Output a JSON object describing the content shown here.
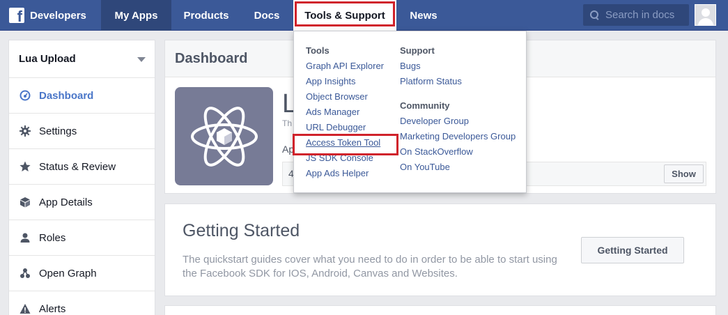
{
  "nav": {
    "brand": "Developers",
    "my_apps": "My Apps",
    "products": "Products",
    "docs": "Docs",
    "tools_support": "Tools & Support",
    "news": "News",
    "search_placeholder": "Search in docs"
  },
  "sidebar": {
    "app_name": "Lua Upload",
    "items": [
      {
        "label": "Dashboard",
        "icon": "dashboard-icon"
      },
      {
        "label": "Settings",
        "icon": "gear-icon"
      },
      {
        "label": "Status & Review",
        "icon": "star-icon"
      },
      {
        "label": "App Details",
        "icon": "cube-icon"
      },
      {
        "label": "Roles",
        "icon": "person-icon"
      },
      {
        "label": "Open Graph",
        "icon": "graph-icon"
      },
      {
        "label": "Alerts",
        "icon": "alert-icon"
      }
    ]
  },
  "dashboard": {
    "title": "Dashboard",
    "app_name_partial": "L",
    "app_sub_partial": "Th",
    "app_id_partial": "Ap",
    "secret_partial": "4",
    "show_label": "Show"
  },
  "getting_started": {
    "title": "Getting Started",
    "description": "The quickstart guides cover what you need to do in order to be able to start using the Facebook SDK for IOS, Android, Canvas and Websites.",
    "button": "Getting Started"
  },
  "dropdown": {
    "tools_heading": "Tools",
    "tools": [
      "Graph API Explorer",
      "App Insights",
      "Object Browser",
      "Ads Manager",
      "URL Debugger",
      "Access Token Tool",
      "JS SDK Console",
      "App Ads Helper"
    ],
    "support_heading": "Support",
    "support": [
      "Bugs",
      "Platform Status"
    ],
    "community_heading": "Community",
    "community": [
      "Developer Group",
      "Marketing Developers Group",
      "On StackOverflow",
      "On YouTube"
    ]
  },
  "colors": {
    "nav_bg": "#3b5998",
    "highlight": "#d0222b",
    "link": "#3b5998",
    "active": "#4a76c8"
  }
}
